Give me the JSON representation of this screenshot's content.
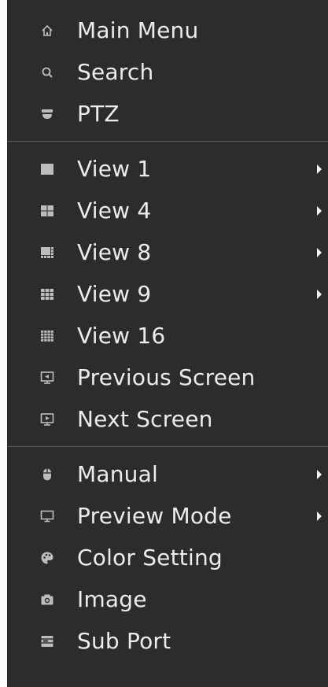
{
  "menu": {
    "items": [
      {
        "label": "Main Menu",
        "icon": "home-icon"
      },
      {
        "label": "Search",
        "icon": "search-icon"
      },
      {
        "label": "PTZ",
        "icon": "ptz-camera-icon"
      },
      {
        "label": "View 1",
        "icon": "view-1-icon",
        "has_submenu": true
      },
      {
        "label": "View 4",
        "icon": "view-4-icon",
        "has_submenu": true
      },
      {
        "label": "View 8",
        "icon": "view-8-icon",
        "has_submenu": true
      },
      {
        "label": "View 9",
        "icon": "view-9-icon",
        "has_submenu": true
      },
      {
        "label": "View 16",
        "icon": "view-16-icon"
      },
      {
        "label": "Previous Screen",
        "icon": "previous-screen-icon"
      },
      {
        "label": "Next Screen",
        "icon": "next-screen-icon"
      },
      {
        "label": "Manual",
        "icon": "mouse-icon",
        "has_submenu": true
      },
      {
        "label": "Preview Mode",
        "icon": "monitor-icon",
        "has_submenu": true
      },
      {
        "label": "Color Setting",
        "icon": "palette-icon"
      },
      {
        "label": "Image",
        "icon": "camera-icon"
      },
      {
        "label": "Sub Port",
        "icon": "sub-port-icon"
      }
    ]
  },
  "colors": {
    "background": "#2c2c2c",
    "text": "#ececec",
    "icon": "#bdbdbd",
    "divider": "#5a5a5a"
  }
}
